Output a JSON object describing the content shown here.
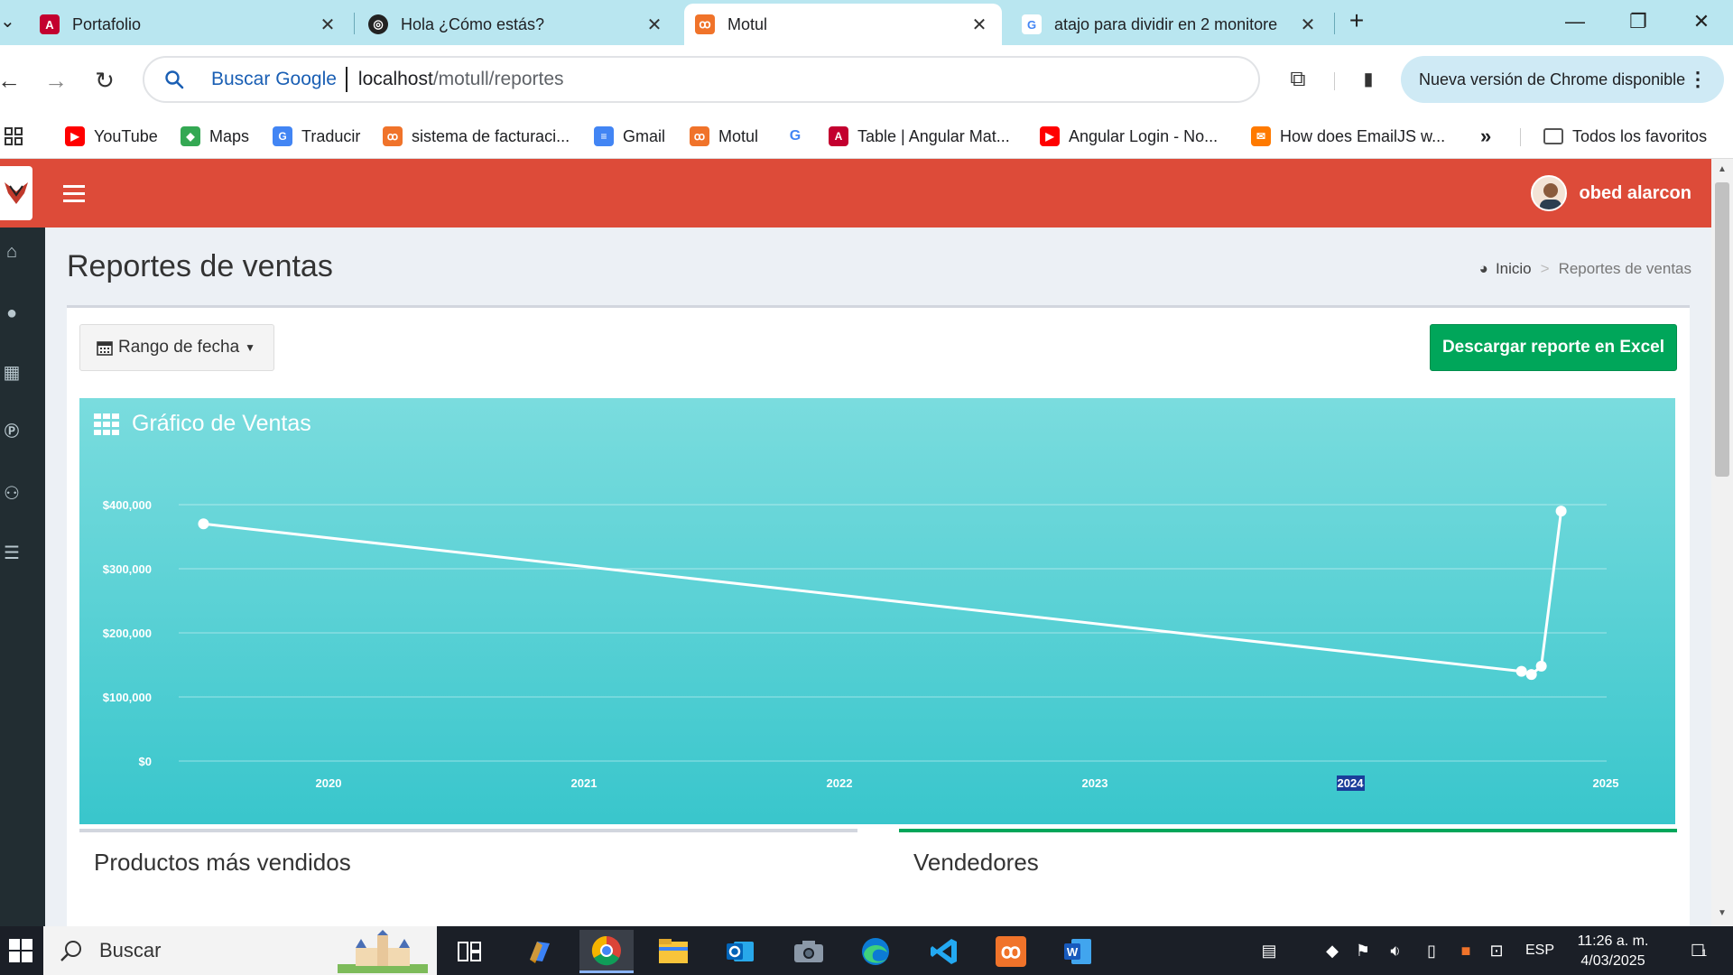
{
  "browser": {
    "tabs": [
      {
        "title": "Portafolio",
        "favicon": "angular-icon",
        "color": "#c3002f"
      },
      {
        "title": "Hola ¿Cómo estás?",
        "favicon": "openai-icon",
        "color": "#222222"
      },
      {
        "title": "Motul",
        "favicon": "xampp-icon",
        "color": "#f0732a"
      },
      {
        "title": "atajo para dividir en 2 monitore",
        "favicon": "google-icon",
        "color": "#4285f4"
      }
    ],
    "active_tab": 2,
    "omnibox": {
      "hint": "Buscar Google",
      "url_host": "localhost",
      "url_path": "/motull/reportes"
    },
    "update_chip": "Nueva versión de Chrome disponible",
    "bookmarks": [
      {
        "label": "YouTube",
        "icon": "youtube-icon",
        "color": "#ff0000"
      },
      {
        "label": "Maps",
        "icon": "maps-icon",
        "color": "#34a853"
      },
      {
        "label": "Traducir",
        "icon": "translate-icon",
        "color": "#4285f4"
      },
      {
        "label": "sistema de facturaci...",
        "icon": "xampp-icon",
        "color": "#f0732a"
      },
      {
        "label": "Gmail",
        "icon": "docs-icon",
        "color": "#4285f4"
      },
      {
        "label": "Motul",
        "icon": "xampp-icon",
        "color": "#f0732a"
      },
      {
        "label": "",
        "icon": "google-icon",
        "color": "#4285f4"
      },
      {
        "label": "Table | Angular Mat...",
        "icon": "angular-icon",
        "color": "#c3002f"
      },
      {
        "label": "Angular Login - No...",
        "icon": "youtube-icon",
        "color": "#ff0000"
      },
      {
        "label": "How does EmailJS w...",
        "icon": "emailjs-icon",
        "color": "#ff7a00"
      }
    ],
    "bookmarks_overflow": "»",
    "all_bookmarks": "Todos los favoritos"
  },
  "app": {
    "user_name": "obed alarcon",
    "page_title": "Reportes de ventas",
    "breadcrumb": {
      "home": "Inicio",
      "current": "Reportes de ventas"
    },
    "date_range_button": "Rango de fecha",
    "excel_button": "Descargar reporte en Excel",
    "chart_title": "Gráfico de Ventas",
    "panels": {
      "left_title": "Productos más vendidos",
      "right_title": "Vendedores"
    },
    "colors": {
      "header": "#dd4b39",
      "sidebar": "#222d32",
      "excel": "#00a65a",
      "chart": "#39c6cc"
    }
  },
  "chart_data": {
    "type": "line",
    "title": "Gráfico de Ventas",
    "x_tick_labels": [
      "2020",
      "2021",
      "2022",
      "2023",
      "2024",
      "2025"
    ],
    "y_tick_labels": [
      "$0",
      "$100,000",
      "$200,000",
      "$300,000",
      "$400,000"
    ],
    "ylim": [
      0,
      400000
    ],
    "xlim": [
      2019.5,
      2025.0
    ],
    "grid": true,
    "points": [
      {
        "x": 2019.6,
        "y": 370000
      },
      {
        "x": 2024.92,
        "y": 140000
      },
      {
        "x": 2024.96,
        "y": 135000
      },
      {
        "x": 2025.0,
        "y": 148000
      },
      {
        "x": 2025.08,
        "y": 390000
      }
    ]
  },
  "taskbar": {
    "search_placeholder": "Buscar",
    "apps": [
      "task-view-icon",
      "copilot-icon",
      "chrome-icon",
      "explorer-icon",
      "outlook-icon",
      "camera-icon",
      "edge-icon",
      "vscode-icon",
      "xampp-icon",
      "word-icon"
    ],
    "language": "ESP",
    "time": "11:26 a. m.",
    "date": "4/03/2025",
    "notifications": "1"
  }
}
